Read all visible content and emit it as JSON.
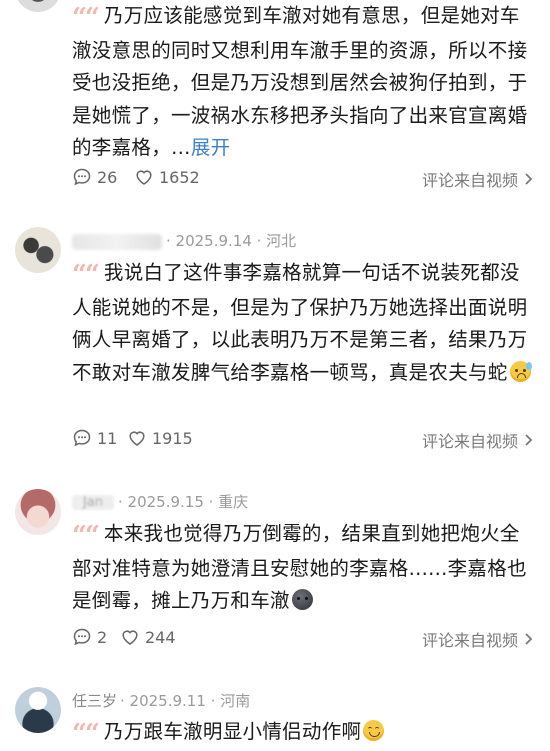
{
  "comments": [
    {
      "user": "",
      "date": "",
      "location": "",
      "text": "乃万应该能感觉到车澈对她有意思，但是她对车澈没意思的同时又想利用车澈手里的资源，所以不接受也没拒绝，但是乃万没想到居然会被狗仔拍到，于是她慌了，一波祸水东移把矛头指向了出来官宣离婚的李嘉格，…",
      "expand_label": "展开",
      "comments_count": "26",
      "likes_count": "1652",
      "source_label": "评论来自视频"
    },
    {
      "user": "",
      "date": "· 2025.9.14 · 河北",
      "text": "我说白了这件事李嘉格就算一句话不说装死都没人能说她的不是，但是为了保护乃万她选择出面说明俩人早离婚了，以此表明乃万不是第三者，结果乃万不敢对车澈发脾气给李嘉格一顿骂，真是农夫与蛇",
      "emoji": "anxious-sweat-emoji",
      "comments_count": "11",
      "likes_count": "1915",
      "source_label": "评论来自视频"
    },
    {
      "user": "Jan",
      "date": "· 2025.9.15 · 重庆",
      "text": "本来我也觉得乃万倒霉的，结果直到她把炮火全部对准特意为她澄清且安慰她的李嘉格......李嘉格也是倒霉，摊上乃万和车澈",
      "emoji": "dark-face-emoji",
      "comments_count": "2",
      "likes_count": "244",
      "source_label": "评论来自视频"
    },
    {
      "user": "任三岁",
      "date": "· 2025.9.11 · 河南",
      "text": "乃万跟车澈明显小情侣动作啊",
      "emoji": "smile-emoji"
    }
  ],
  "colors": {
    "quote_mark": "#f0b8b0",
    "expand_link": "#3f7fc7",
    "meta_text": "#9a9a9a"
  }
}
